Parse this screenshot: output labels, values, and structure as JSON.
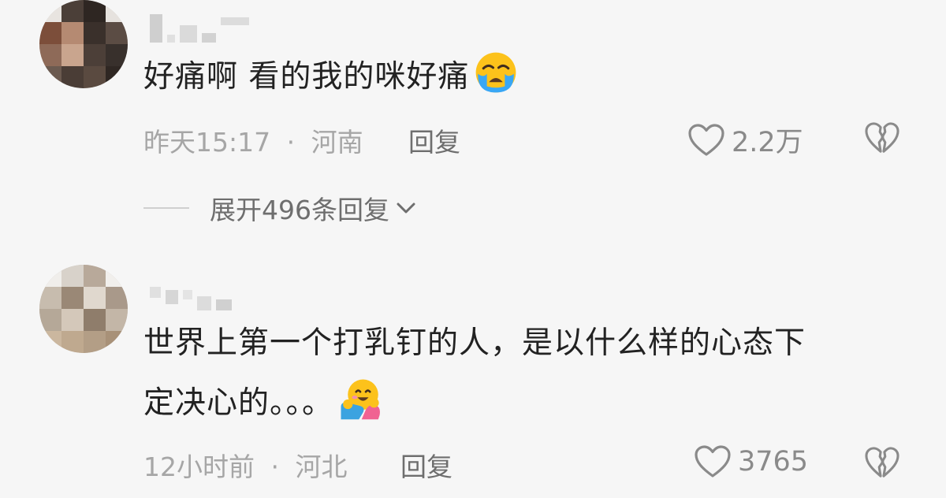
{
  "comments": [
    {
      "text": "好痛啊 看的我的咪好痛",
      "emoji": "loudly-crying-face",
      "time": "昨天15:17",
      "dot": "·",
      "location": "河南",
      "reply_label": "回复",
      "likes": "2.2万",
      "expand_label": "展开496条回复",
      "avatar_colors": [
        "#5a4a40",
        "#c8b7a8",
        "#3b2f2a",
        "#7a6a5e"
      ]
    },
    {
      "text_line1": "世界上第一个打乳钉的人，是以什么样的心态下",
      "text_line2": "定决心的。。。",
      "emoji": "smiling-face-with-open-hands",
      "time": "12小时前",
      "dot": "·",
      "location": "河北",
      "reply_label": "回复",
      "likes": "3765",
      "avatar_colors": [
        "#c9c0b4",
        "#a89684",
        "#d9cfc2",
        "#8e7b68"
      ]
    }
  ],
  "colors": {
    "background": "#f6f6f6",
    "text": "#222222",
    "meta": "#a6a6a6",
    "icon": "#8a8a8a"
  }
}
